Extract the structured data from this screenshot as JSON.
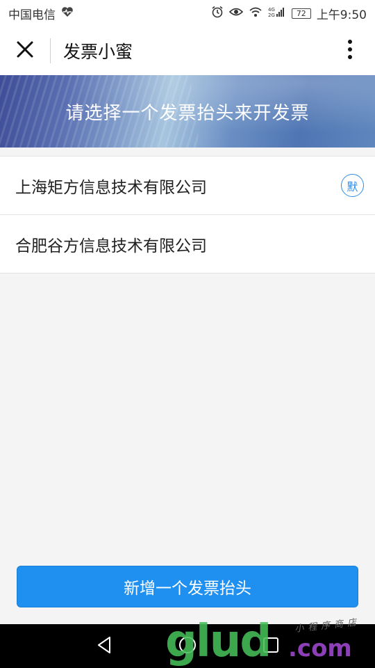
{
  "status_bar": {
    "carrier": "中国电信",
    "battery": "72",
    "time": "上午9:50",
    "icons": [
      "heart-pulse-icon",
      "alarm-icon",
      "eye-icon",
      "wifi-icon",
      "signal-icon",
      "battery-icon"
    ]
  },
  "nav": {
    "title": "发票小蜜",
    "close_icon": "close-icon",
    "more_icon": "more-vertical-icon"
  },
  "banner": {
    "text": "请选择一个发票抬头来开发票"
  },
  "invoice_titles": [
    {
      "name": "上海矩方信息技术有限公司",
      "badge": "默"
    },
    {
      "name": "合肥谷方信息技术有限公司",
      "badge": ""
    }
  ],
  "actions": {
    "add_title_label": "新增一个发票抬头"
  },
  "system_nav": {
    "icons": [
      "back-icon",
      "home-icon",
      "recents-icon"
    ]
  },
  "watermark": {
    "main": "glud",
    "com": ".com",
    "sub": "小程序商店"
  },
  "colors": {
    "primary": "#1f90ef",
    "badge": "#2d8ce8",
    "background": "#f4f4f4"
  }
}
